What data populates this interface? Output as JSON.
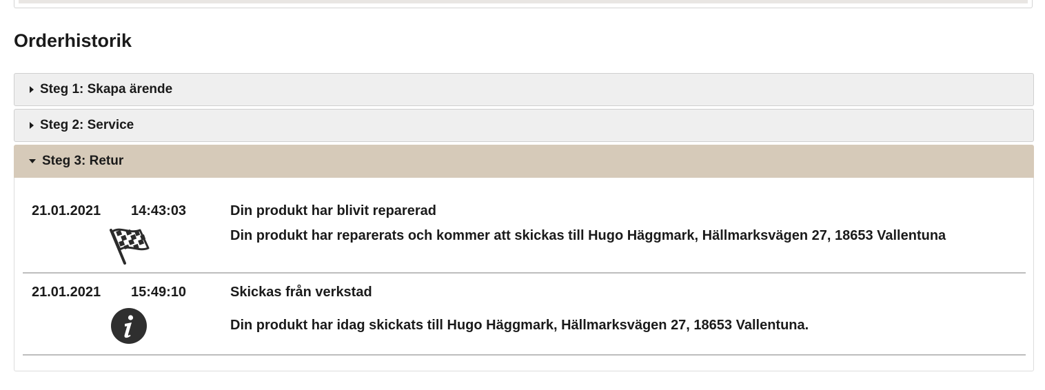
{
  "page_title": "Orderhistorik",
  "accordion": {
    "sections": [
      {
        "label": "Steg 1: Skapa ärende",
        "expanded": false
      },
      {
        "label": "Steg 2: Service",
        "expanded": false
      },
      {
        "label": "Steg 3: Retur",
        "expanded": true
      }
    ],
    "active_color": "#d6cab9",
    "inactive_color": "#efefef"
  },
  "events": [
    {
      "date": "21.01.2021",
      "time": "14:43:03",
      "icon": "checkered-flag-icon",
      "title": "Din produkt har blivit reparerad",
      "description": "Din produkt har reparerats och kommer att skickas till Hugo Häggmark, Hällmarksvägen 27, 18653 Vallentuna"
    },
    {
      "date": "21.01.2021",
      "time": "15:49:10",
      "icon": "info-icon",
      "title": "Skickas från verkstad",
      "description": "Din produkt har idag skickats till Hugo Häggmark, Hällmarksvägen 27, 18653 Vallentuna."
    }
  ]
}
